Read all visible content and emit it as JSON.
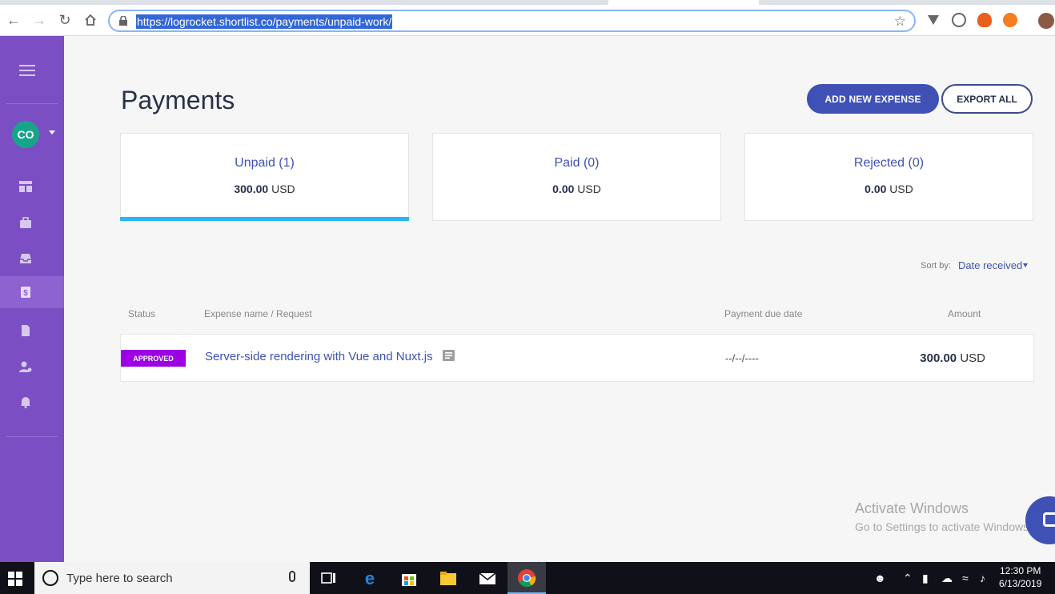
{
  "browser": {
    "url": "https://logrocket.shortlist.co/payments/unpaid-work/"
  },
  "sidebar": {
    "avatar_initials": "CO",
    "items": [
      {
        "icon": "dashboard-icon"
      },
      {
        "icon": "briefcase-icon"
      },
      {
        "icon": "inbox-icon"
      },
      {
        "icon": "payments-icon",
        "active": true
      },
      {
        "icon": "document-icon"
      },
      {
        "icon": "user-settings-icon"
      },
      {
        "icon": "bell-icon"
      }
    ]
  },
  "page": {
    "title": "Payments",
    "add_button": "ADD NEW EXPENSE",
    "export_button": "EXPORT ALL"
  },
  "summary_cards": [
    {
      "title": "Unpaid (1)",
      "amount": "300.00",
      "currency": "USD",
      "selected": true
    },
    {
      "title": "Paid (0)",
      "amount": "0.00",
      "currency": "USD"
    },
    {
      "title": "Rejected (0)",
      "amount": "0.00",
      "currency": "USD"
    }
  ],
  "sort": {
    "label": "Sort by:",
    "value": "Date received"
  },
  "table": {
    "headers": {
      "status": "Status",
      "name": "Expense name / Request",
      "due_date": "Payment due date",
      "amount": "Amount"
    },
    "rows": [
      {
        "status": "APPROVED",
        "name": "Server-side rendering with Vue and Nuxt.js",
        "due_date": "--/--/----",
        "amount": "300.00",
        "currency": "USD"
      }
    ]
  },
  "watermark": {
    "line1": "Activate Windows",
    "line2": "Go to Settings to activate Windows."
  },
  "taskbar": {
    "search_placeholder": "Type here to search",
    "time": "12:30 PM",
    "date": "6/13/2019"
  },
  "colors": {
    "sidebar": "#7b4fc3",
    "primary": "#3f51b5",
    "approved_badge": "#9c00e4",
    "active_underline": "#29b6f6"
  }
}
